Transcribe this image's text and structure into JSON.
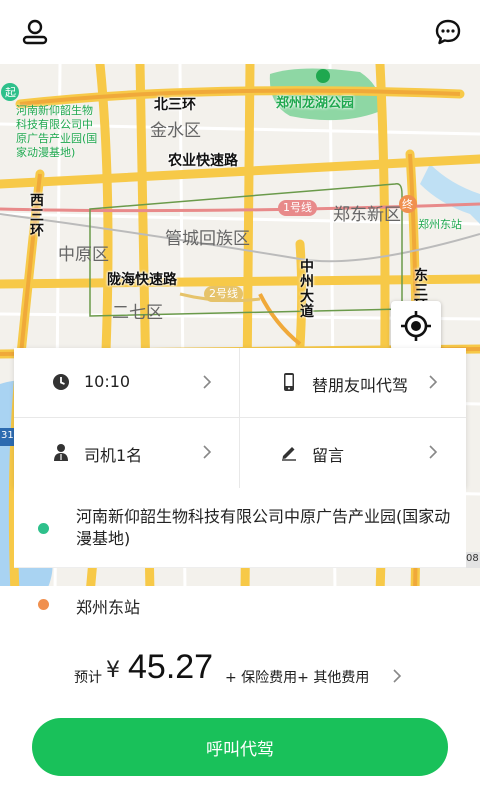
{
  "topbar": {
    "profile_icon": "user-icon",
    "message_icon": "chat-bubble-icon"
  },
  "map": {
    "districts": [
      "金水区",
      "中原区",
      "管城回族区",
      "郑东新区",
      "二七区"
    ],
    "roads": [
      "北三环",
      "农业快速路",
      "陇海快速路",
      "西三环",
      "中州大道",
      "东三环"
    ],
    "metro": [
      "1号线",
      "2号线"
    ],
    "park": "郑州龙湖公园",
    "start_badge": "起",
    "end_badge": "终",
    "start_poi": "河南新仰韶生物科技有限公司中原广告产业园(国家动漫基地)",
    "end_poi": "郑州东站",
    "edge_labels": [
      "31",
      "08"
    ],
    "colors": {
      "road": "#f7c948",
      "expressway": "#f0a93a",
      "water": "#a9d3f2",
      "park": "#8ed7a4"
    }
  },
  "options": {
    "time": "10:10",
    "proxy": "替朋友叫代驾",
    "drivers": "司机1名",
    "message": "留言"
  },
  "route": {
    "start": "河南新仰韶生物科技有限公司中原广告产业园(国家动漫基地)",
    "end": "郑州东站"
  },
  "price": {
    "prefix": "预计",
    "currency": "¥",
    "amount": "45.27",
    "extra": "+ 保险费用+ 其他费用"
  },
  "actions": {
    "call_label": "呼叫代驾"
  },
  "colors": {
    "accent": "#19c15a",
    "start_dot": "#2ec08b",
    "end_dot": "#f0904f"
  }
}
